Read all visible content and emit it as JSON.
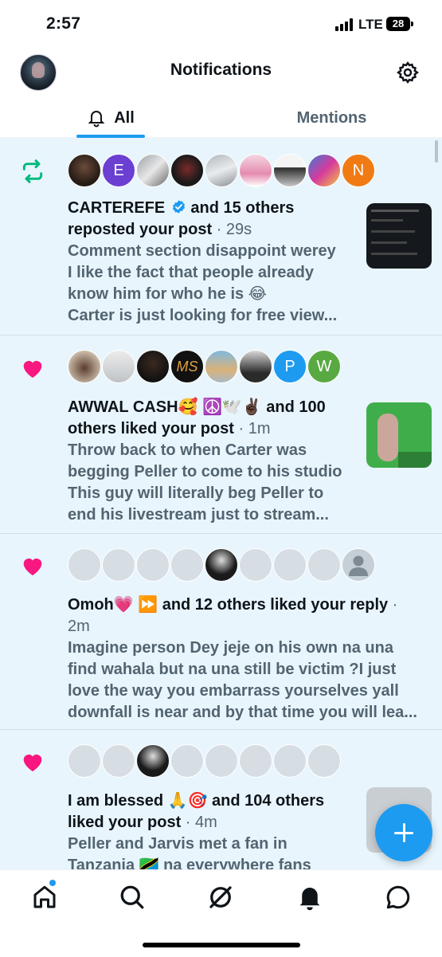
{
  "status_bar": {
    "time": "2:57",
    "network": "LTE",
    "battery": "28"
  },
  "header": {
    "title": "Notifications"
  },
  "tabs": [
    {
      "label": "All"
    },
    {
      "label": "Mentions"
    }
  ],
  "notifications": [
    {
      "type": "repost",
      "avatar_letters": [
        "E",
        "N"
      ],
      "actor": "CARTEREFE",
      "action": " and 15 others reposted your post",
      "time": " · 29s",
      "preview": [
        "Comment section disappoint werey",
        "I like the fact that people already",
        "know him for who he is 😂",
        "Carter is just looking for free view..."
      ]
    },
    {
      "type": "like",
      "avatar_letters": [
        "P",
        "W"
      ],
      "actor": "AWWAL CASH🥰 ☮️🕊️✌🏿",
      "action": " and 100 others liked your post",
      "time": " · 1m",
      "preview": [
        "Throw back to when Carter was",
        "begging Peller to come to his studio",
        "This guy will literally beg Peller to",
        "end his livestream just to stream..."
      ]
    },
    {
      "type": "like",
      "actor": "Omoh💗 ⏩",
      "action": " and 12 others liked your reply",
      "time": " · 2m",
      "preview": [
        "Imagine person Dey jeje on his own na una",
        "find wahala but na una still be victim ?I just",
        "love the way you embarrass yourselves yall",
        "downfall is near and by that time you will lea..."
      ]
    },
    {
      "type": "like",
      "actor": "I am blessed 🙏🎯",
      "action": " and 104 others liked your post",
      "time": " · 4m",
      "preview": [
        "Peller and Jarvis met a fan in",
        "Tanzania 🇹🇿 na everywhere fans"
      ]
    }
  ],
  "colors": {
    "accent": "#1d9bf0",
    "repost": "#00ba7c",
    "like": "#f91880",
    "unread_bg": "#e8f5fd"
  }
}
